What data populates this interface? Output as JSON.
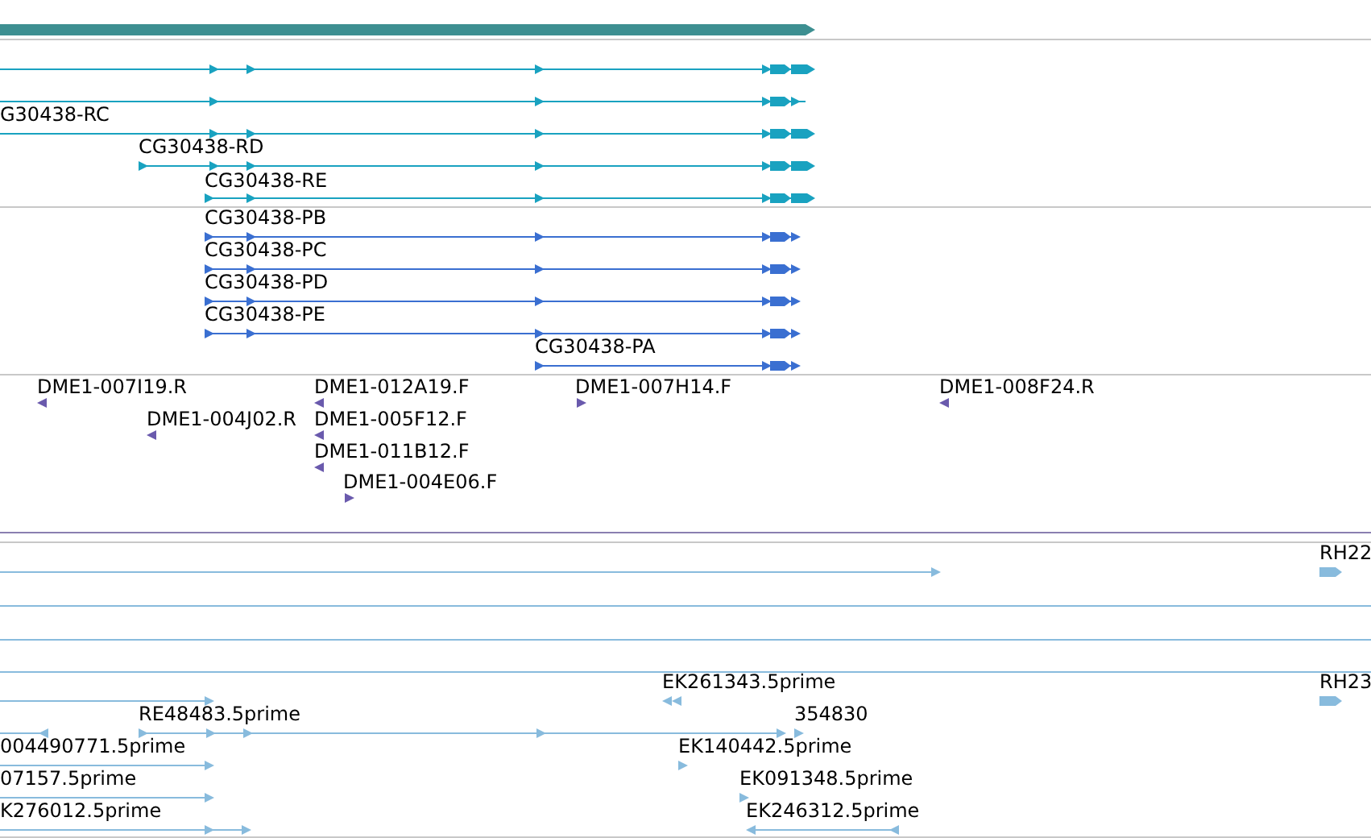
{
  "transcript_labels": [
    "G30438-RC",
    "CG30438-RD",
    "CG30438-RE"
  ],
  "protein_labels": [
    "CG30438-PB",
    "CG30438-PC",
    "CG30438-PD",
    "CG30438-PE",
    "CG30438-PA"
  ],
  "clone_ends": [
    {
      "label": "DME1-007I19.R",
      "kind": "reverse"
    },
    {
      "label": "DME1-012A19.F",
      "kind": "reverse"
    },
    {
      "label": "DME1-007H14.F",
      "kind": "forward"
    },
    {
      "label": "DME1-008F24.R",
      "kind": "reverse"
    },
    {
      "label": "DME1-004J02.R",
      "kind": "reverse"
    },
    {
      "label": "DME1-005F12.F",
      "kind": "reverse"
    },
    {
      "label": "DME1-011B12.F",
      "kind": "reverse"
    },
    {
      "label": "DME1-004E06.F",
      "kind": "forward"
    }
  ],
  "est_labels": [
    "RH22",
    "EK261343.5prime",
    "RH23",
    "RE48483.5prime",
    "354830",
    "004490771.5prime",
    "EK140442.5prime",
    "07157.5prime",
    "EK091348.5prime",
    "K276012.5prime",
    "EK246312.5prime"
  ]
}
